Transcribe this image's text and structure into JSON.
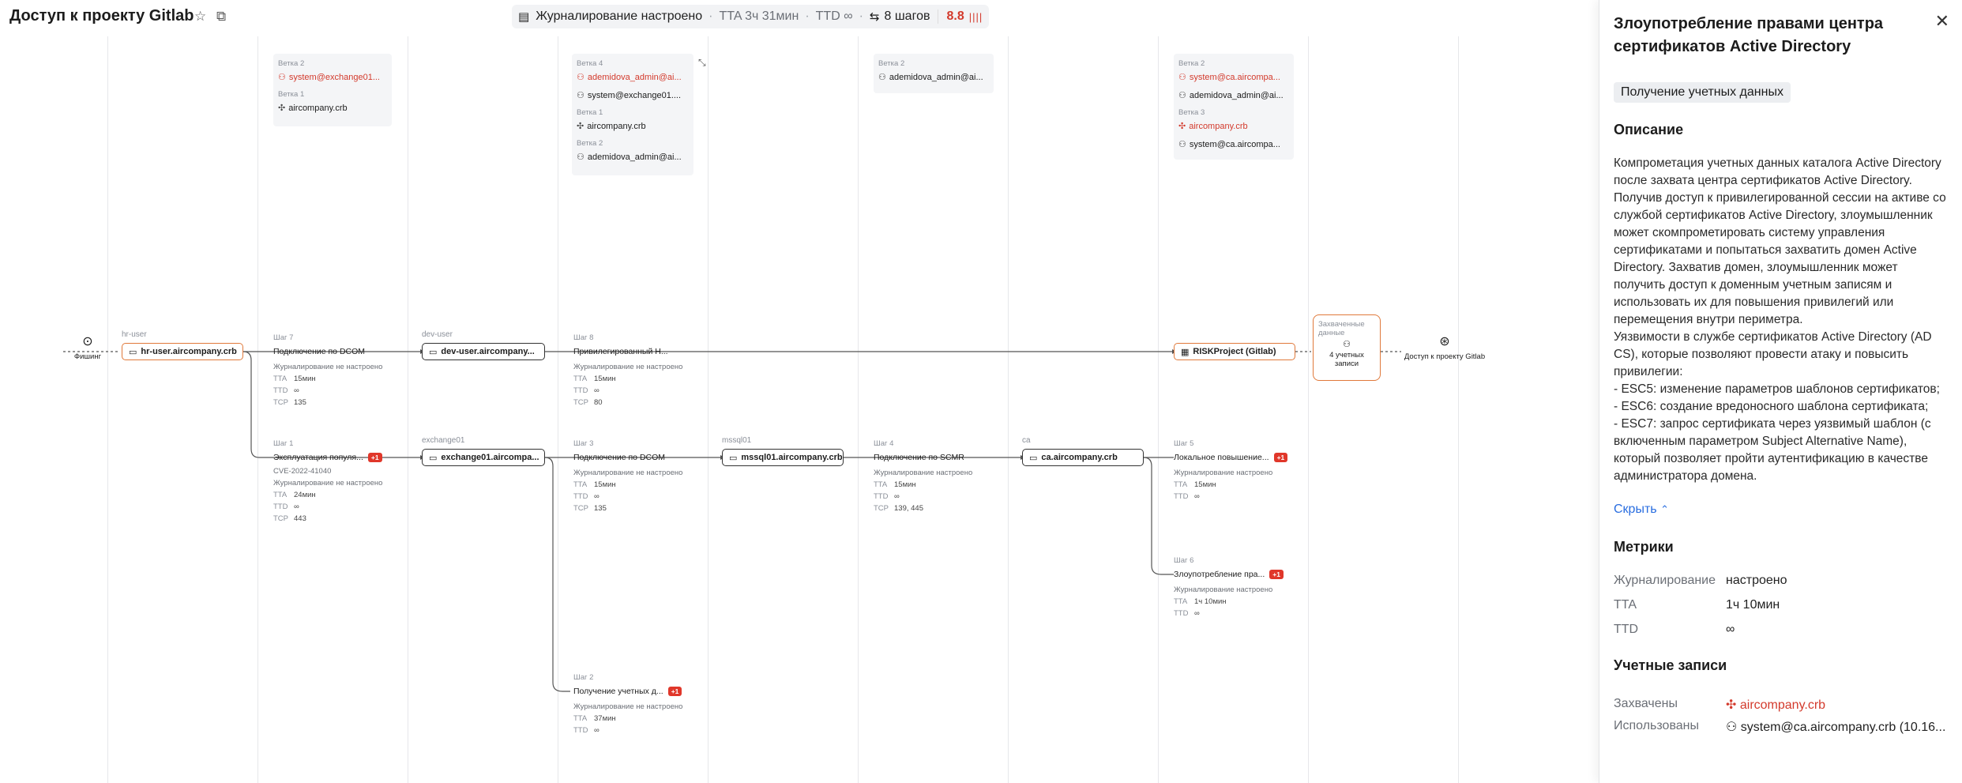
{
  "header": {
    "title": "Доступ к проекту Gitlab",
    "logging": "Журналирование настроено",
    "tta": "TTA 3ч 31мин",
    "ttd": "TTD ∞",
    "steps": "8 шагов",
    "risk": "8.8"
  },
  "canvas": {
    "start": "Фишинг",
    "end": "Доступ к проекту Gitlab",
    "groups": {
      "g1": [
        {
          "label": "Ветка 2",
          "account": "system@exchange01...",
          "red": true,
          "icon": "user-icon"
        },
        {
          "label": "Ветка 1",
          "account": "aircompany.crb",
          "red": false,
          "icon": "domain-icon"
        }
      ],
      "g2": [
        {
          "label": "Ветка 4",
          "account": "ademidova_admin@ai...",
          "red": true,
          "icon": "user-icon"
        },
        {
          "label": "",
          "account": "system@exchange01....",
          "red": false,
          "icon": "user-icon"
        },
        {
          "label": "Ветка 1",
          "account": "aircompany.crb",
          "red": false,
          "icon": "domain-icon"
        },
        {
          "label": "Ветка 2",
          "account": "ademidova_admin@ai...",
          "red": false,
          "icon": "user-icon"
        }
      ],
      "g3": [
        {
          "label": "Ветка 2",
          "account": "ademidova_admin@ai...",
          "red": false,
          "icon": "user-icon"
        }
      ],
      "g4": [
        {
          "label": "Ветка 2",
          "account": "system@ca.aircompa...",
          "red": true,
          "icon": "user-icon"
        },
        {
          "label": "",
          "account": "ademidova_admin@ai...",
          "red": false,
          "icon": "user-icon"
        },
        {
          "label": "Ветка 3",
          "account": "aircompany.crb",
          "red": true,
          "icon": "domain-icon"
        },
        {
          "label": "",
          "account": "system@ca.aircompa...",
          "red": false,
          "icon": "user-icon"
        }
      ]
    },
    "hosts": {
      "hr_user": {
        "label": "hr-user",
        "name": "hr-user.aircompany.crb"
      },
      "dev_user": {
        "label": "dev-user",
        "name": "dev-user.aircompany..."
      },
      "exchange01": {
        "label": "exchange01",
        "name": "exchange01.aircompa..."
      },
      "mssql01": {
        "label": "mssql01",
        "name": "mssql01.aircompany.crb"
      },
      "ca": {
        "label": "ca",
        "name": "ca.aircompany.crb"
      },
      "risk": {
        "label": "",
        "name": "RISKProject (Gitlab)"
      }
    },
    "steps": {
      "s7": {
        "n": "Шаг 7",
        "name": "Подключение по DCOM",
        "log": "Журналирование не настроено",
        "tta": "15мин",
        "ttd": "∞",
        "tcp": "135"
      },
      "s1": {
        "n": "Шаг 1",
        "name": "Эксплуатация популя...",
        "badge": "+1",
        "cve": "CVE-2022-41040",
        "log": "Журналирование не настроено",
        "tta": "24мин",
        "ttd": "∞",
        "tcp": "443"
      },
      "s8": {
        "n": "Шаг 8",
        "name": "Привилегированный Н...",
        "log": "Журналирование не настроено",
        "tta": "15мин",
        "ttd": "∞",
        "tcp": "80"
      },
      "s3": {
        "n": "Шаг 3",
        "name": "Подключение по DCOM",
        "log": "Журналирование не настроено",
        "tta": "15мин",
        "ttd": "∞",
        "tcp": "135"
      },
      "s2": {
        "n": "Шаг 2",
        "name": "Получение учетных д...",
        "badge": "+1",
        "log": "Журналирование не настроено",
        "tta": "37мин",
        "ttd": "∞"
      },
      "s4": {
        "n": "Шаг 4",
        "name": "Подключение по SCMR",
        "log": "Журналирование настроено",
        "tta": "15мин",
        "ttd": "∞",
        "tcp": "139, 445"
      },
      "s5": {
        "n": "Шаг 5",
        "name": "Локальное повышение...",
        "badge": "+1",
        "log": "Журналирование настроено",
        "tta": "15мин",
        "ttd": "∞"
      },
      "s6": {
        "n": "Шаг 6",
        "name": "Злоупотребление пра...",
        "badge": "+1",
        "log": "Журналирование настроено",
        "tta": "1ч 10мин",
        "ttd": "∞"
      }
    },
    "captured": {
      "title": "Захваченные данные",
      "count": "4 учетных записи"
    }
  },
  "panel": {
    "title": "Злоупотребление правами центра сертификатов Active Directory",
    "tag": "Получение учетных данных",
    "description_heading": "Описание",
    "description": [
      "Компрометация учетных данных каталога Active Directory после захвата центра сертификатов Active Directory.",
      "Получив доступ к привилегированной сессии на активе со службой сертификатов Active Directory, злоумышленник может скомпрометировать систему управления сертификатами и попытаться захватить домен Active Directory. Захватив домен, злоумышленник может получить доступ к доменным учетным записям и использовать их для повышения привилегий или перемещения внутри периметра.",
      "Уязвимости в службе сертификатов Active Directory (AD CS), которые позволяют провести атаку и повысить привилегии:",
      "- ESC5: изменение параметров шаблонов сертификатов;",
      "- ESC6: создание вредоносного шаблона сертификата;",
      "- ESC7: запрос сертификата через уязвимый шаблон (с включенным параметром Subject Alternative Name), который позволяет пройти аутентификацию в качестве администратора домена."
    ],
    "hide": "Скрыть",
    "metrics_heading": "Метрики",
    "metrics": [
      {
        "k": "Журналирование",
        "v": "настроено"
      },
      {
        "k": "TTA",
        "v": "1ч 10мин"
      },
      {
        "k": "TTD",
        "v": "∞"
      }
    ],
    "accounts_heading": "Учетные записи",
    "captured_label": "Захвачены",
    "captured_value": "aircompany.crb",
    "used_label": "Использованы",
    "used_value": "system@ca.aircompany.crb (10.16..."
  }
}
